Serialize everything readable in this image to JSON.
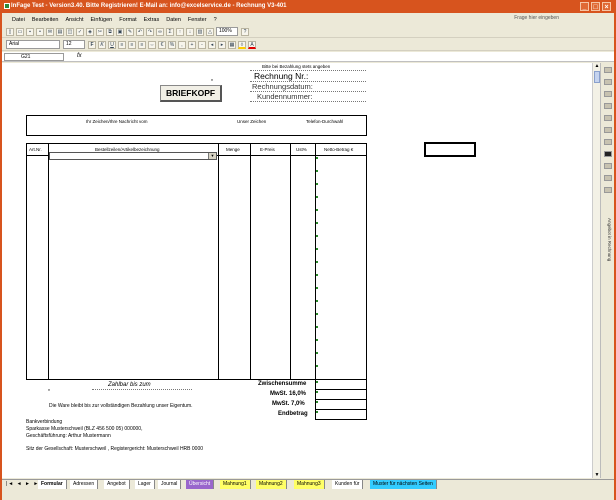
{
  "titlebar": {
    "title": "InFage Test - Version3.40. Bitte Registrieren! E-Mail an: info@excelservice.de - Rechnung V3-401"
  },
  "window_buttons": {
    "minimize": "_",
    "maximize": "□",
    "close": "×"
  },
  "menu": [
    "Datei",
    "Bearbeiten",
    "Ansicht",
    "Einfügen",
    "Format",
    "Extras",
    "Daten",
    "Fenster",
    "?"
  ],
  "help_placeholder": "Frage hier eingeben",
  "toolbar": {
    "zoom": "100%",
    "font": "Arial",
    "size": "12"
  },
  "formula_bar": {
    "cell": "G21",
    "fx": "fx",
    "value": ""
  },
  "invoice": {
    "payment_hint": "Bitte bei Bezahlung stets angeben",
    "rechnung_nr": "Rechnung Nr.:",
    "rechnungsdatum": "Rechnungsdatum:",
    "kundennummer": "Kundennummer:",
    "briefkopf": "BRIEFKOPF",
    "asterisk": "*",
    "ref_headers": [
      "Ihr Zeichen/Ihre Nachricht vom",
      "Unser Zeichen",
      "Telefon-Durchwahl"
    ],
    "columns": [
      "Art.Nr.",
      "Bestellzeilen/Artikelbezeichnung",
      "Menge",
      "E-Preis",
      "Ust%",
      "Netto-Betrag €"
    ],
    "zahlbar": "Zahlbar bis zum",
    "zwischensumme": "Zwischensumme",
    "mwst16": "MwSt. 16,0%",
    "mwst7": "MwSt. 7,0%",
    "endbetrag": "Endbetrag",
    "eigentum": "Die Ware bleibt bis zur vollständigen Bezahlung unser Eigentum.",
    "bank1": "Bankverbindung",
    "bank2": "Sparkasse Musterschweil (BLZ 456 500 05) 000000,",
    "bank3": "Geschäftsführung: Arthur Mustermann",
    "sitz": "Sitz der Gesellschaft:  Musterschweil   , Registergericht: Musterschweil HRB 0000"
  },
  "taskpane": {
    "label": "Angebot in Rechnung"
  },
  "sheet_tabs": [
    {
      "label": "Formular",
      "bg": "#ffffff"
    },
    {
      "label": "Adressen",
      "bg": "#ffffff"
    },
    {
      "label": "Angebot",
      "bg": "#ffffff"
    },
    {
      "label": "Lager",
      "bg": "#ffffff"
    },
    {
      "label": "Journal",
      "bg": "#ffffff"
    },
    {
      "label": "Übersicht",
      "bg": "#9966cc"
    },
    {
      "label": "Mahnung1",
      "bg": "#ffff66"
    },
    {
      "label": "Mahnung2",
      "bg": "#ffff66"
    },
    {
      "label": "Mahnung3",
      "bg": "#ffff66"
    },
    {
      "label": "Kunden für",
      "bg": "#ffffff"
    },
    {
      "label": "Muster für nächsten Seiten",
      "bg": "#33ccff"
    }
  ],
  "tab_nav": "|◄ ◄ ► ►|"
}
